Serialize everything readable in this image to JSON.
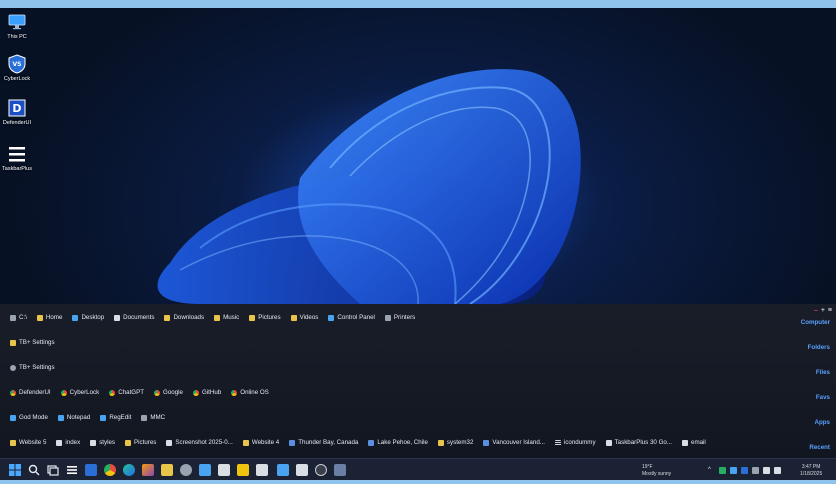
{
  "desktop_icons": [
    {
      "label": "This PC",
      "icon": "monitor-icon"
    },
    {
      "label": "CyberLock",
      "icon": "shield-vs-icon"
    },
    {
      "label": "DefenderUI",
      "icon": "defender-d-icon"
    },
    {
      "label": "TaskbarPlus",
      "icon": "hamburger-menu-icon"
    }
  ],
  "panel": {
    "controls": {
      "minimize": "–",
      "add": "+",
      "menu": "≡"
    },
    "categories": [
      "Computer",
      "Folders",
      "Files",
      "Favs",
      "Apps",
      "Recent"
    ],
    "computer": [
      "C:\\",
      "Home",
      "Desktop",
      "Documents",
      "Downloads",
      "Music",
      "Pictures",
      "Videos",
      "Control Panel",
      "Printers"
    ],
    "folders": [
      "TB+ Settings"
    ],
    "files": [
      "TB+ Settings"
    ],
    "favs": [
      "DefenderUI",
      "CyberLock",
      "ChatGPT",
      "Google",
      "GitHub",
      "Online OS"
    ],
    "apps": [
      "God Mode",
      "Notepad",
      "RegEdit",
      "MMC"
    ],
    "recent": [
      "Website 5",
      "index",
      "styles",
      "Pictures",
      "Screenshot 2025-0...",
      "Website 4",
      "Thunder Bay, Canada",
      "Lake Pehoe, Chile",
      "system32",
      "Vancouver Island...",
      "icondummy",
      "TaskbarPlus 30 Go...",
      "email"
    ]
  },
  "taskbar": {
    "weather_temp": "19°F",
    "weather_desc": "Mostly sunny",
    "time": "3:47 PM",
    "date": "1/18/2025"
  },
  "colors": {
    "accent_category": "#5aa0ff",
    "taskbar_bg": "#1b2233",
    "panel_bg": "#1a1e28"
  }
}
